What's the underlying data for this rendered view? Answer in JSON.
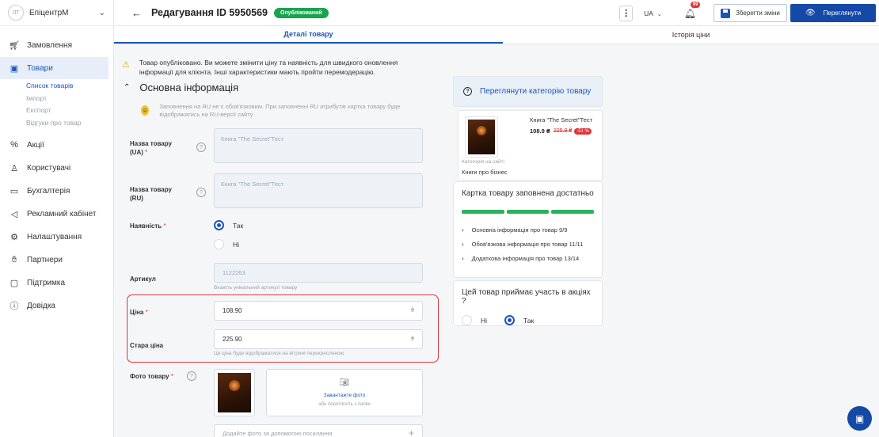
{
  "sidebar": {
    "avatar_text": "ЛТ",
    "brand": "ЕпіцентрМ",
    "items": [
      {
        "label": "Замовлення",
        "icon": "cart-icon"
      },
      {
        "label": "Товари",
        "icon": "box-icon"
      },
      {
        "label": "Акції",
        "icon": "percent-icon"
      },
      {
        "label": "Користувачі",
        "icon": "users-icon"
      },
      {
        "label": "Бухгалтерія",
        "icon": "wallet-icon"
      },
      {
        "label": "Рекламний кабінет",
        "icon": "megaphone-icon"
      },
      {
        "label": "Налаштування",
        "icon": "gear-icon"
      },
      {
        "label": "Партнери",
        "icon": "handshake-icon"
      },
      {
        "label": "Підтримка",
        "icon": "chat-icon"
      },
      {
        "label": "Довідка",
        "icon": "help-icon"
      }
    ],
    "subitems": [
      "Список товарів",
      "Імпорт",
      "Експорт",
      "Відгуки про товар"
    ]
  },
  "header": {
    "title": "Редагування ID 5950569",
    "status": "Опублікований",
    "lang": "UA",
    "notifications": "99",
    "save_label": "Зберегти зміни",
    "view_label": "Переглянути"
  },
  "tabs": [
    "Деталі товару",
    "Історія ціни"
  ],
  "notice": "Товар опубліковано. Ви можете змінити ціну та наявність для швидкого оновлення інформації для клієнта. Інші характеристики мають пройти перемодерацію.",
  "section_title": "Основна інформація",
  "hint": "Заповнення на RU не є обов'язковим. При заповненні RU атрибутів картка товару буде відображатись на RU-версії сайту",
  "form": {
    "name_ua_label": "Назва товару (UA)",
    "name_ua_value": "Книга \"The Secret\"Тест",
    "name_ru_label": "Назва товару (RU)",
    "name_ru_value": "Книга \"The Secret\"Тест",
    "availability_label": "Наявність",
    "availability_yes": "Так",
    "availability_no": "Ні",
    "sku_label": "Артикул",
    "sku_value": "1122263",
    "sku_note": "Вкажіть унікальний артикул товару",
    "price_label": "Ціна",
    "price_value": "108.90",
    "old_price_label": "Стара ціна",
    "old_price_value": "225.90",
    "old_price_note": "Ця ціна буде відображатися на вітрині перекресленою",
    "currency": "₴",
    "photo_label": "Фото товару",
    "upload_link": "Завантажте фото",
    "upload_sub": "або перетягніть з папки",
    "url_placeholder": "Додайте фото за допомогою посилання"
  },
  "right": {
    "category_link": "Переглянути категорію товару",
    "product_name": "Книга \"The Secret\"Тест",
    "price": "108.9 ₴",
    "old_price": "225.9 ₴",
    "discount": "-51 %",
    "category_label": "Категорія на сайті",
    "category_value": "Книги про бізнес",
    "fill_title": "Картка товару заповнена достатньо",
    "fill_items": [
      "Основна інформація про товар 9/9",
      "Обов'язкова інформація про товар 11/11",
      "Додаткова інформація про товар 13/14"
    ],
    "promo_question": "Цей товар приймає участь в акціях ?",
    "promo_no": "Ні",
    "promo_yes": "Так"
  },
  "colors": {
    "primary": "#1549a8",
    "success": "#19a34f",
    "danger": "#e0343a",
    "warning": "#f0a500"
  }
}
